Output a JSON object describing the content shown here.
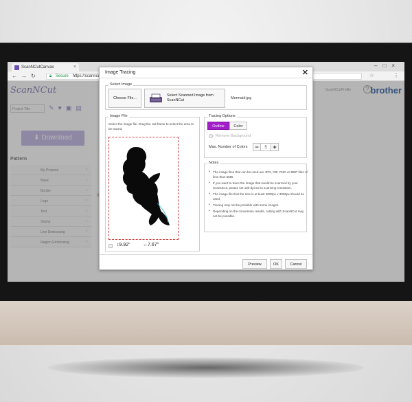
{
  "browser": {
    "tab_title": "ScanNCutCanvas",
    "secure_label": "Secure",
    "url": "https://scanncutcanvas.brother.com/en/Editor/Index?matId=new"
  },
  "app": {
    "logo": "ScanNCut",
    "brand": "brother",
    "profile_text": "ScanNCutProfile",
    "project_title_placeholder": "Project Title",
    "download_label": "Download",
    "pattern_heading": "Pattern",
    "pattern_items": [
      "My Projects",
      "Basic",
      "Border",
      "Logo",
      "Text",
      "Stamp",
      "Line Embossing",
      "Region Embossing"
    ]
  },
  "dialog": {
    "title": "Image Tracing",
    "select_image": {
      "group_title": "Select Image",
      "choose_file_label": "Choose File...",
      "scan_button_label": "Select Scanned Image from ScanNCut",
      "file_name": "Mermaid.jpg"
    },
    "image_file": {
      "group_title": "Image File",
      "instructions": "Select the image file. Drag the red frame to select the area to be traced.",
      "height": "9.92\"",
      "width": "7.67\""
    },
    "tracing_options": {
      "group_title": "Tracing Options",
      "outline_label": "Outline",
      "color_label": "Color",
      "remove_background_label": "Remove Background",
      "max_colors_label": "Max. Number of Colors",
      "max_colors_value": "5"
    },
    "notes": {
      "group_title": "Notes",
      "items": [
        "The image files that can be used are JPG, GIF, PNG or BMP files of less than 5MB.",
        "If you want to trace the image that would be scanned by your ScanNCut, please set 100 dpi as its scanning resolution.",
        "The image file that the size is at least 3000px x 3000px should be used.",
        "Tracing may not be possible with some images.",
        "Depending on the conversion results, cutting with ScanNCut may not be possible."
      ]
    },
    "buttons": {
      "preview": "Preview",
      "ok": "OK",
      "cancel": "Cancel"
    }
  },
  "colors": {
    "accent": "#a21fc8",
    "frame": "#d33a3a",
    "brand_blue": "#1d4f9a"
  }
}
